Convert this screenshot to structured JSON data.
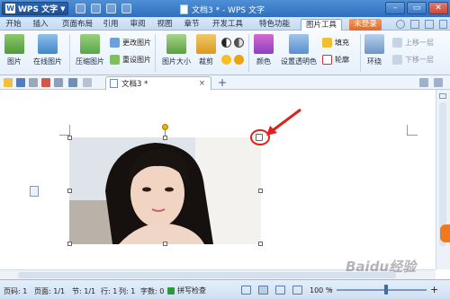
{
  "titlebar": {
    "app_label": "WPS 文字",
    "window_title": "文档3 * - WPS 文字",
    "minimize": "–",
    "maximize": "▭",
    "close": "✕"
  },
  "tabs": [
    "开始",
    "插入",
    "页面布局",
    "引用",
    "审阅",
    "视图",
    "章节",
    "开发工具",
    "特色功能",
    "图片工具",
    "未登录"
  ],
  "active_tab": "图片工具",
  "ribbon": {
    "picture": "图片",
    "online_picture": "在线图片",
    "compress_picture": "压缩图片",
    "change_picture": "更改图片",
    "reset_picture": "重设图片",
    "picture_size": "图片大小",
    "crop": "裁剪",
    "color": "颜色",
    "set_transparent": "设置透明色",
    "fill": "填充",
    "outline": "轮廓",
    "wrap": "环绕",
    "bring_forward": "上移一层",
    "send_backward": "下移一层"
  },
  "doc_tab": {
    "name": "文档3 *",
    "close": "×",
    "new_tab": "+"
  },
  "status": {
    "page": "页码: 1",
    "pages": "页面: 1/1",
    "section": "节: 1/1",
    "row": "行: 1",
    "col": "列: 1",
    "words": "字数: 0",
    "spell_check": "拼写检查",
    "zoom": "100 %",
    "zoom_minus": "–",
    "zoom_plus": "+"
  },
  "watermark": "Baidu经验",
  "colors": {
    "accent": "#2f6fbd",
    "annotation": "#e0201c",
    "login_button": "#e06a2a"
  }
}
